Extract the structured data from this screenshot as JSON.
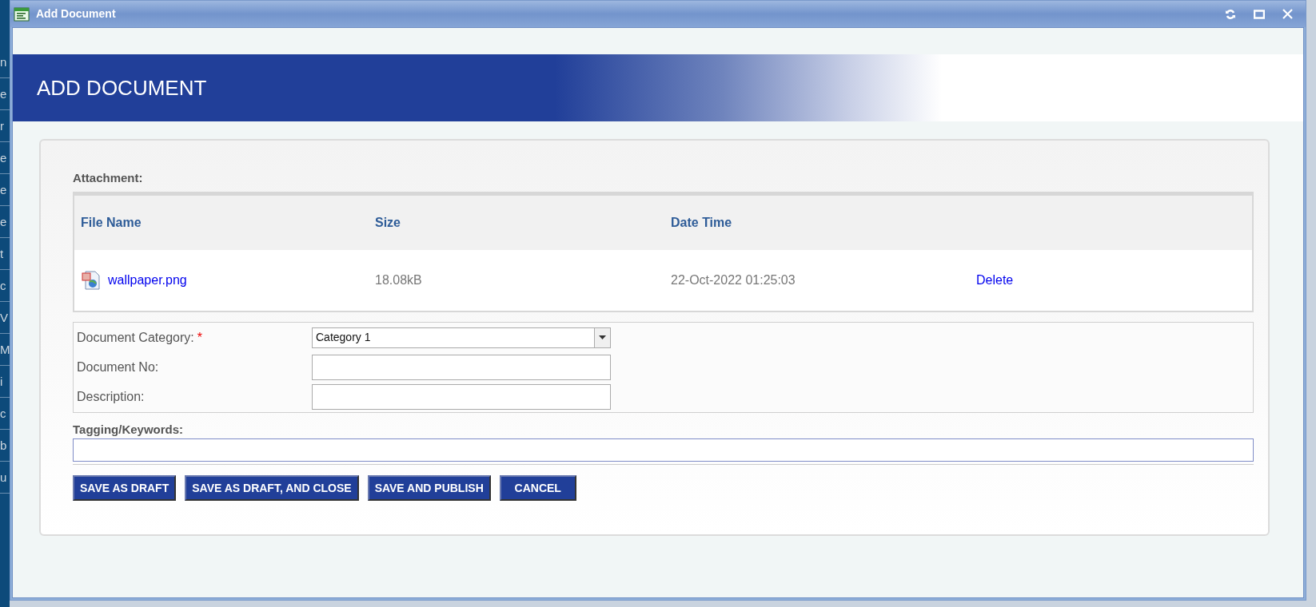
{
  "background_fragments": [
    "n",
    "e",
    "r",
    "e",
    "e",
    "e",
    "t",
    "c",
    "V",
    "M",
    "i",
    "c",
    "b",
    "u"
  ],
  "window": {
    "title": "Add Document"
  },
  "header": {
    "title": "ADD DOCUMENT"
  },
  "attachment": {
    "label": "Attachment:",
    "columns": [
      "File Name",
      "Size",
      "Date Time"
    ],
    "rows": [
      {
        "file_name": "wallpaper.png",
        "size": "18.08kB",
        "date_time": "22-Oct-2022 01:25:03",
        "action": "Delete"
      }
    ]
  },
  "form": [
    {
      "kind": "select",
      "label": "Document Category:",
      "required_mark": "*",
      "value": "Category 1"
    },
    {
      "kind": "text",
      "label": "Document No:"
    },
    {
      "kind": "text",
      "label": "Description:"
    }
  ],
  "tagging": {
    "label": "Tagging/Keywords:"
  },
  "buttons": [
    "SAVE AS DRAFT",
    "SAVE AS DRAFT, AND CLOSE",
    "SAVE AND PUBLISH",
    "CANCEL"
  ]
}
